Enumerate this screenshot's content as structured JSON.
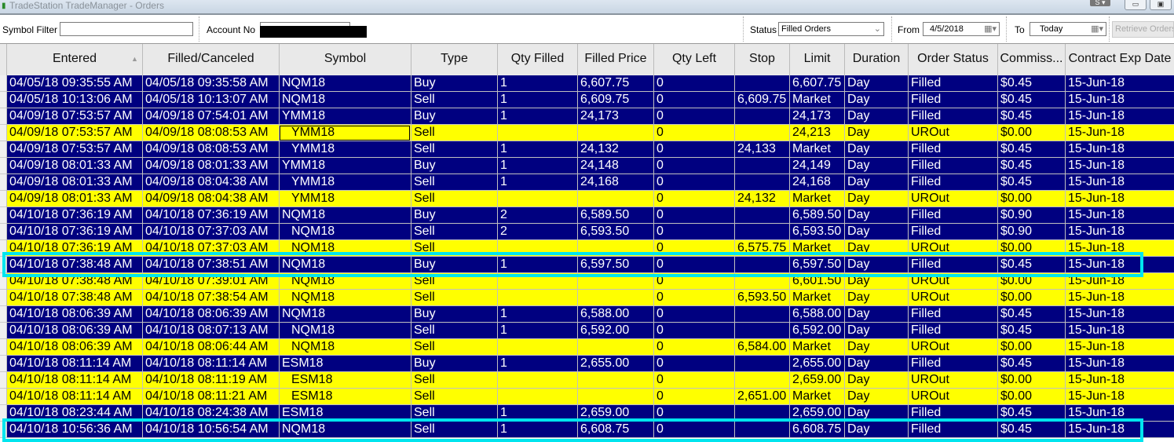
{
  "window": {
    "title": "TradeStation TradeManager - Orders",
    "s_button": "S ▾"
  },
  "toolbar": {
    "symbol_filter_label": "Symbol Filter",
    "symbol_filter_value": "",
    "account_label": "Account No",
    "status_label": "Status",
    "status_value": "Filled Orders",
    "from_label": "From",
    "from_value": "4/5/2018",
    "to_label": "To",
    "to_value": "Today",
    "retrieve_label": "Retrieve Orders"
  },
  "columns": [
    "Entered",
    "Filled/Canceled",
    "Symbol",
    "Type",
    "Qty Filled",
    "Filled Price",
    "Qty Left",
    "Stop",
    "Limit",
    "Duration",
    "Order Status",
    "Commiss...",
    "Contract Exp Date"
  ],
  "rows": [
    {
      "style": "blue",
      "indent": false,
      "cells": [
        "04/05/18 09:35:55 AM",
        "04/05/18 09:35:58 AM",
        "NQM18",
        "Buy",
        "1",
        "6,607.75",
        "0",
        "",
        "6,607.75",
        "Day",
        "Filled",
        "$0.45",
        "15-Jun-18"
      ]
    },
    {
      "style": "blue",
      "indent": false,
      "cells": [
        "04/05/18 10:13:06 AM",
        "04/05/18 10:13:07 AM",
        "NQM18",
        "Sell",
        "1",
        "6,609.75",
        "0",
        "6,609.75",
        "Market",
        "Day",
        "Filled",
        "$0.45",
        "15-Jun-18"
      ]
    },
    {
      "style": "blue",
      "indent": false,
      "cells": [
        "04/09/18 07:53:57 AM",
        "04/09/18 07:54:01 AM",
        "YMM18",
        "Buy",
        "1",
        "24,173",
        "0",
        "",
        "24,173",
        "Day",
        "Filled",
        "$0.45",
        "15-Jun-18"
      ]
    },
    {
      "style": "yellow",
      "indent": true,
      "focus": true,
      "cells": [
        "04/09/18 07:53:57 AM",
        "04/09/18 08:08:53 AM",
        "YMM18",
        "Sell",
        "",
        "",
        "0",
        "",
        "24,213",
        "Day",
        "UROut",
        "$0.00",
        "15-Jun-18"
      ]
    },
    {
      "style": "blue",
      "indent": true,
      "cells": [
        "04/09/18 07:53:57 AM",
        "04/09/18 08:08:53 AM",
        "YMM18",
        "Sell",
        "1",
        "24,132",
        "0",
        "24,133",
        "Market",
        "Day",
        "Filled",
        "$0.45",
        "15-Jun-18"
      ]
    },
    {
      "style": "blue",
      "indent": false,
      "cells": [
        "04/09/18 08:01:33 AM",
        "04/09/18 08:01:33 AM",
        "YMM18",
        "Buy",
        "1",
        "24,148",
        "0",
        "",
        "24,149",
        "Day",
        "Filled",
        "$0.45",
        "15-Jun-18"
      ]
    },
    {
      "style": "blue",
      "indent": true,
      "cells": [
        "04/09/18 08:01:33 AM",
        "04/09/18 08:04:38 AM",
        "YMM18",
        "Sell",
        "1",
        "24,168",
        "0",
        "",
        "24,168",
        "Day",
        "Filled",
        "$0.45",
        "15-Jun-18"
      ]
    },
    {
      "style": "yellow",
      "indent": true,
      "cells": [
        "04/09/18 08:01:33 AM",
        "04/09/18 08:04:38 AM",
        "YMM18",
        "Sell",
        "",
        "",
        "0",
        "24,132",
        "Market",
        "Day",
        "UROut",
        "$0.00",
        "15-Jun-18"
      ]
    },
    {
      "style": "blue",
      "indent": false,
      "cells": [
        "04/10/18 07:36:19 AM",
        "04/10/18 07:36:19 AM",
        "NQM18",
        "Buy",
        "2",
        "6,589.50",
        "0",
        "",
        "6,589.50",
        "Day",
        "Filled",
        "$0.90",
        "15-Jun-18"
      ]
    },
    {
      "style": "blue",
      "indent": true,
      "cells": [
        "04/10/18 07:36:19 AM",
        "04/10/18 07:37:03 AM",
        "NQM18",
        "Sell",
        "2",
        "6,593.50",
        "0",
        "",
        "6,593.50",
        "Day",
        "Filled",
        "$0.90",
        "15-Jun-18"
      ]
    },
    {
      "style": "yellow",
      "indent": true,
      "cells": [
        "04/10/18 07:36:19 AM",
        "04/10/18 07:37:03 AM",
        "NQM18",
        "Sell",
        "",
        "",
        "0",
        "6,575.75",
        "Market",
        "Day",
        "UROut",
        "$0.00",
        "15-Jun-18"
      ]
    },
    {
      "style": "blue",
      "indent": false,
      "cells": [
        "04/10/18 07:38:48 AM",
        "04/10/18 07:38:51 AM",
        "NQM18",
        "Buy",
        "1",
        "6,597.50",
        "0",
        "",
        "6,597.50",
        "Day",
        "Filled",
        "$0.45",
        "15-Jun-18"
      ]
    },
    {
      "style": "yellow",
      "indent": true,
      "cells": [
        "04/10/18 07:38:48 AM",
        "04/10/18 07:39:01 AM",
        "NQM18",
        "Sell",
        "",
        "",
        "0",
        "",
        "6,601.50",
        "Day",
        "UROut",
        "$0.00",
        "15-Jun-18"
      ]
    },
    {
      "style": "yellow",
      "indent": true,
      "cells": [
        "04/10/18 07:38:48 AM",
        "04/10/18 07:38:54 AM",
        "NQM18",
        "Sell",
        "",
        "",
        "0",
        "6,593.50",
        "Market",
        "Day",
        "UROut",
        "$0.00",
        "15-Jun-18"
      ]
    },
    {
      "style": "blue",
      "indent": false,
      "cells": [
        "04/10/18 08:06:39 AM",
        "04/10/18 08:06:39 AM",
        "NQM18",
        "Buy",
        "1",
        "6,588.00",
        "0",
        "",
        "6,588.00",
        "Day",
        "Filled",
        "$0.45",
        "15-Jun-18"
      ]
    },
    {
      "style": "blue",
      "indent": true,
      "cells": [
        "04/10/18 08:06:39 AM",
        "04/10/18 08:07:13 AM",
        "NQM18",
        "Sell",
        "1",
        "6,592.00",
        "0",
        "",
        "6,592.00",
        "Day",
        "Filled",
        "$0.45",
        "15-Jun-18"
      ]
    },
    {
      "style": "yellow",
      "indent": true,
      "cells": [
        "04/10/18 08:06:39 AM",
        "04/10/18 08:06:44 AM",
        "NQM18",
        "Sell",
        "",
        "",
        "0",
        "6,584.00",
        "Market",
        "Day",
        "UROut",
        "$0.00",
        "15-Jun-18"
      ]
    },
    {
      "style": "blue",
      "indent": false,
      "cells": [
        "04/10/18 08:11:14 AM",
        "04/10/18 08:11:14 AM",
        "ESM18",
        "Buy",
        "1",
        "2,655.00",
        "0",
        "",
        "2,655.00",
        "Day",
        "Filled",
        "$0.45",
        "15-Jun-18"
      ]
    },
    {
      "style": "yellow",
      "indent": true,
      "cells": [
        "04/10/18 08:11:14 AM",
        "04/10/18 08:11:19 AM",
        "ESM18",
        "Sell",
        "",
        "",
        "0",
        "",
        "2,659.00",
        "Day",
        "UROut",
        "$0.00",
        "15-Jun-18"
      ]
    },
    {
      "style": "yellow",
      "indent": true,
      "cells": [
        "04/10/18 08:11:14 AM",
        "04/10/18 08:11:21 AM",
        "ESM18",
        "Sell",
        "",
        "",
        "0",
        "2,651.00",
        "Market",
        "Day",
        "UROut",
        "$0.00",
        "15-Jun-18"
      ]
    },
    {
      "style": "blue",
      "indent": false,
      "cells": [
        "04/10/18 08:23:44 AM",
        "04/10/18 08:24:38 AM",
        "ESM18",
        "Sell",
        "1",
        "2,659.00",
        "0",
        "",
        "2,659.00",
        "Day",
        "Filled",
        "$0.45",
        "15-Jun-18"
      ]
    },
    {
      "style": "blue",
      "indent": false,
      "cells": [
        "04/10/18 10:56:36 AM",
        "04/10/18 10:56:54 AM",
        "NQM18",
        "Sell",
        "1",
        "6,608.75",
        "0",
        "",
        "6,608.75",
        "Day",
        "Filled",
        "$0.45",
        "15-Jun-18"
      ]
    }
  ],
  "highlight_color": "#00e5ee"
}
